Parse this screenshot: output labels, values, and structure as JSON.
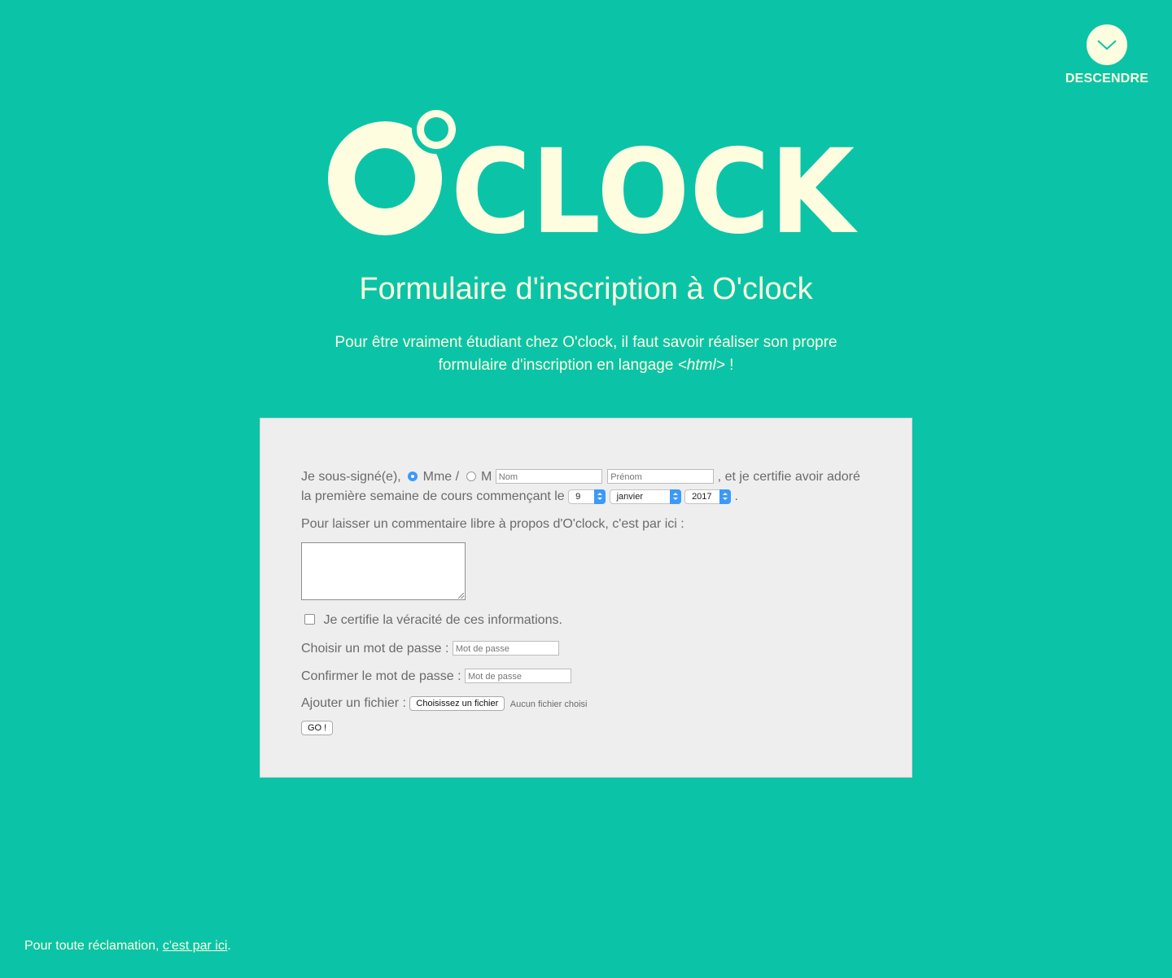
{
  "nav": {
    "descend_label": "DESCENDRE",
    "descend_icon": "chevron-down-icon"
  },
  "logo": {
    "text": "CLOCK",
    "alt": "O'clock"
  },
  "page": {
    "title": "Formulaire d'inscription à O'clock",
    "intro_line1": "Pour être vraiment étudiant chez O'clock, il faut savoir réaliser son propre",
    "intro_line2_prefix": "formulaire d'inscription en langage ",
    "intro_code": "<html>",
    "intro_suffix": " !"
  },
  "form": {
    "signed_prefix": "Je sous-signé(e),",
    "mme_label": "Mme /",
    "m_label": "M",
    "selected_civility": "Mme",
    "nom_placeholder": "Nom",
    "prenom_placeholder": "Prénom",
    "certify_text": ", et je certifie avoir adoré",
    "week_text": "la première semaine de cours commençant le",
    "day_value": "9",
    "month_value": "janvier",
    "year_value": "2017",
    "week_end": ".",
    "comment_label": "Pour laisser un commentaire libre à propos d'O'clock, c'est par ici :",
    "truth_label": "Je certifie la véracité de ces informations.",
    "password_label": "Choisir un mot de passe :",
    "password_placeholder": "Mot de passe",
    "confirm_label": "Confirmer le mot de passe :",
    "confirm_placeholder": "Mot de passe",
    "file_label": "Ajouter un fichier :",
    "file_button": "Choisissez un fichier",
    "file_status": "Aucun fichier choisi",
    "submit_label": "GO !"
  },
  "footer": {
    "prefix": "Pour toute réclamation, ",
    "link": "c'est par ici",
    "suffix": "."
  },
  "colors": {
    "background": "#0bc4a7",
    "cream": "#fffde0",
    "card": "#eeeeee",
    "accent_blue": "#3b99fc"
  }
}
